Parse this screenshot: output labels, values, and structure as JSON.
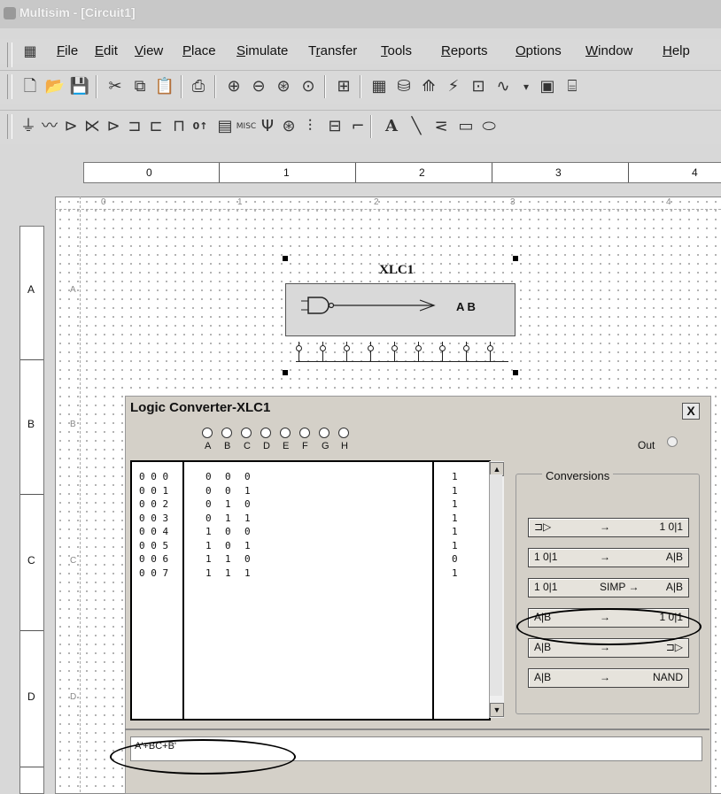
{
  "window": {
    "title": "Multisim - [Circuit1]"
  },
  "menu": [
    "File",
    "Edit",
    "View",
    "Place",
    "Simulate",
    "Transfer",
    "Tools",
    "Reports",
    "Options",
    "Window",
    "Help"
  ],
  "menu_accel": [
    "F",
    "E",
    "V",
    "P",
    "S",
    "r",
    "T",
    "R",
    "O",
    "W",
    "H"
  ],
  "toolbar1_icons": [
    "new-icon",
    "open-icon",
    "save-icon",
    "cut-icon",
    "copy-icon",
    "paste-icon",
    "print-icon",
    "zoom-in-icon",
    "zoom-out-icon",
    "zoom-area-icon",
    "zoom-fit-icon",
    "hierarchy-icon",
    "spreadsheet-icon",
    "database-icon",
    "component-wizard-icon",
    "probe-icon",
    "grapher-icon",
    "waveform-icon",
    "postprocessor-icon",
    "more-icon"
  ],
  "toolbar2_icons": [
    "source-icon",
    "basic-icon",
    "diode-icon",
    "transistor-icon",
    "analog-icon",
    "ttl-icon",
    "cmos-icon",
    "misc-digital-icon",
    "mixed-icon",
    "indicator-icon",
    "misc-icon",
    "rf-icon",
    "electromech-icon",
    "ladder-icon",
    "hierarchical-block-icon",
    "bus-icon",
    "text-icon",
    "line-icon",
    "polyline-icon",
    "rectangle-icon",
    "ellipse-icon"
  ],
  "ruler": {
    "columns": [
      "0",
      "1",
      "2",
      "3",
      "4"
    ],
    "rows": [
      "A",
      "B",
      "C",
      "D"
    ],
    "inner_columns": [
      "0",
      "1",
      "2",
      "3",
      "4"
    ],
    "inner_rows": [
      "A",
      "B",
      "C",
      "D"
    ]
  },
  "component": {
    "label": "XLC1",
    "output_text": "A B"
  },
  "logic_converter": {
    "title": "Logic Converter-XLC1",
    "close": "X",
    "inputs": [
      "A",
      "B",
      "C",
      "D",
      "E",
      "F",
      "G",
      "H"
    ],
    "out_label": "Out",
    "rows": [
      {
        "index": "0 0 0",
        "a": "0",
        "b": "0",
        "c": "0",
        "out": "1"
      },
      {
        "index": "0 0 1",
        "a": "0",
        "b": "0",
        "c": "1",
        "out": "1"
      },
      {
        "index": "0 0 2",
        "a": "0",
        "b": "1",
        "c": "0",
        "out": "1"
      },
      {
        "index": "0 0 3",
        "a": "0",
        "b": "1",
        "c": "1",
        "out": "1"
      },
      {
        "index": "0 0 4",
        "a": "1",
        "b": "0",
        "c": "0",
        "out": "1"
      },
      {
        "index": "0 0 5",
        "a": "1",
        "b": "0",
        "c": "1",
        "out": "1"
      },
      {
        "index": "0 0 6",
        "a": "1",
        "b": "1",
        "c": "0",
        "out": "0"
      },
      {
        "index": "0 0 7",
        "a": "1",
        "b": "1",
        "c": "1",
        "out": "1"
      }
    ],
    "conversions_title": "Conversions",
    "buttons": [
      {
        "left": "⊐▷",
        "arrow": "→",
        "right": "1 0|1"
      },
      {
        "left": "1 0|1",
        "arrow": "→",
        "right": "A|B"
      },
      {
        "left": "1 0|1",
        "arrow": "SIMP →",
        "right": "A|B"
      },
      {
        "left": "A|B",
        "arrow": "→",
        "right": "1 0|1"
      },
      {
        "left": "A|B",
        "arrow": "→",
        "right": "⊐▷"
      },
      {
        "left": "A|B",
        "arrow": "→",
        "right": "NAND"
      }
    ],
    "expression": "A'+BC+B'"
  }
}
